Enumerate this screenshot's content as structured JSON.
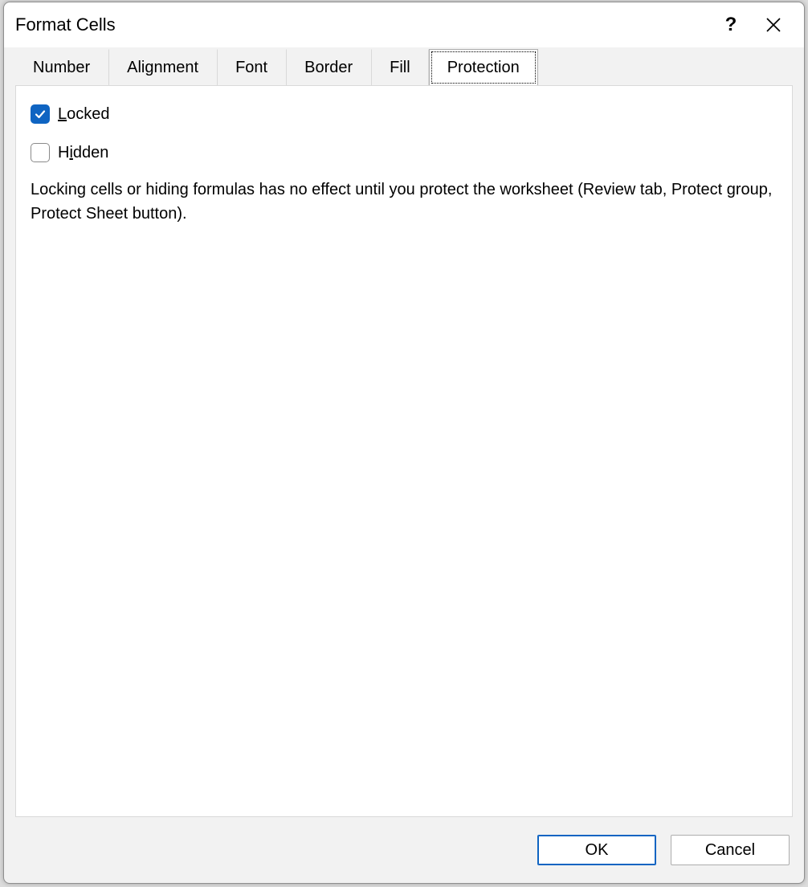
{
  "dialog": {
    "title": "Format Cells"
  },
  "tabs": {
    "items": [
      {
        "label": "Number"
      },
      {
        "label": "Alignment"
      },
      {
        "label": "Font"
      },
      {
        "label": "Border"
      },
      {
        "label": "Fill"
      },
      {
        "label": "Protection"
      }
    ],
    "active_index": 5
  },
  "protection": {
    "locked": {
      "label_pre": "L",
      "label_rest": "ocked",
      "underline": "L",
      "checked": true
    },
    "hidden": {
      "label_pre": "H",
      "label_mid_u": "i",
      "label_rest": "dden",
      "checked": false
    },
    "description": "Locking cells or hiding formulas has no effect until you protect the worksheet (Review tab, Protect group, Protect Sheet button)."
  },
  "buttons": {
    "ok": "OK",
    "cancel": "Cancel"
  },
  "icons": {
    "help": "?",
    "close": "✕"
  },
  "colors": {
    "accent": "#0f64c2",
    "panel_bg": "#ffffff",
    "dialog_bg": "#f2f2f2",
    "border": "#adadad"
  }
}
